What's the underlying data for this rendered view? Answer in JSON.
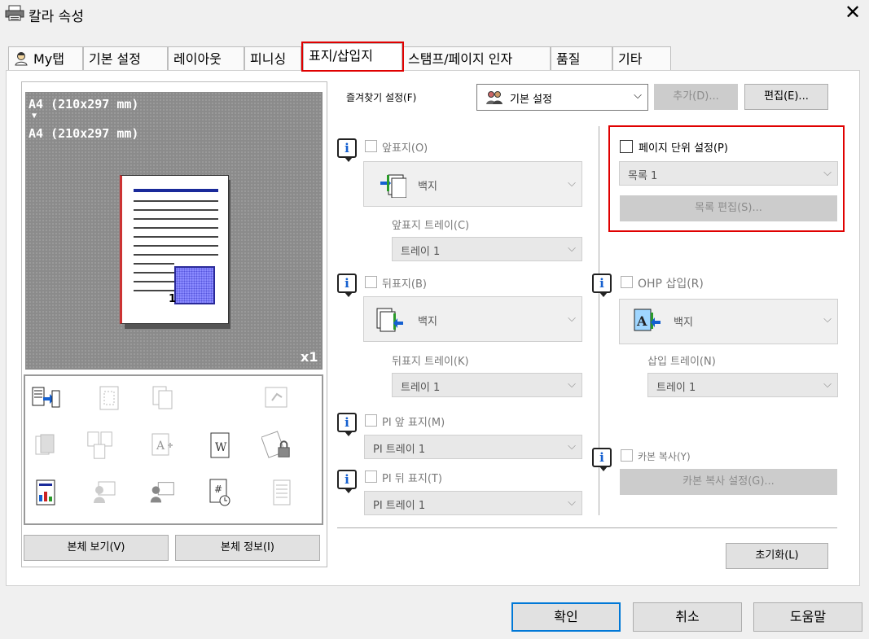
{
  "window": {
    "title": "칼라 속성",
    "close_label": "✕"
  },
  "tabs": [
    {
      "label": "My탭"
    },
    {
      "label": "기본 설정"
    },
    {
      "label": "레이아웃"
    },
    {
      "label": "피니싱"
    },
    {
      "label": "표지/삽입지"
    },
    {
      "label": "스탬프/페이지 인자"
    },
    {
      "label": "품질"
    },
    {
      "label": "기타"
    }
  ],
  "preview": {
    "paper_from": "A4 (210x297 mm)",
    "arrow": "▼",
    "paper_to": "A4 (210x297 mm)",
    "copies": "x1",
    "page_number": "1",
    "view_button": "본체 보기(V)",
    "info_button": "본체 정보(I)"
  },
  "favorites": {
    "label": "즐겨찾기 설정(F)",
    "value": "기본 설정",
    "add_button": "추가(D)...",
    "edit_button": "편집(E)..."
  },
  "front_cover": {
    "label": "앞표지(O)",
    "paper": "백지",
    "tray_label": "앞표지 트레이(C)",
    "tray": "트레이 1"
  },
  "back_cover": {
    "label": "뒤표지(B)",
    "paper": "백지",
    "tray_label": "뒤표지 트레이(K)",
    "tray": "트레이 1"
  },
  "pi_front": {
    "label": "PI 앞 표지(M)",
    "tray": "PI 트레이 1"
  },
  "pi_back": {
    "label": "PI 뒤 표지(T)",
    "tray": "PI 트레이 1"
  },
  "per_page": {
    "label": "페이지 단위 설정(P)",
    "list": "목록 1",
    "edit_button": "목록 편집(S)..."
  },
  "ohp": {
    "label": "OHP 삽입(R)",
    "paper": "백지",
    "tray_label": "삽입 트레이(N)",
    "tray": "트레이 1"
  },
  "carbon": {
    "label": "카본 복사(Y)",
    "settings_button": "카본 복사 설정(G)..."
  },
  "reset_button": "초기화(L)",
  "footer": {
    "ok": "확인",
    "cancel": "취소",
    "help": "도움말"
  },
  "colors": {
    "highlight": "#e00000",
    "accent": "#1560d0"
  }
}
